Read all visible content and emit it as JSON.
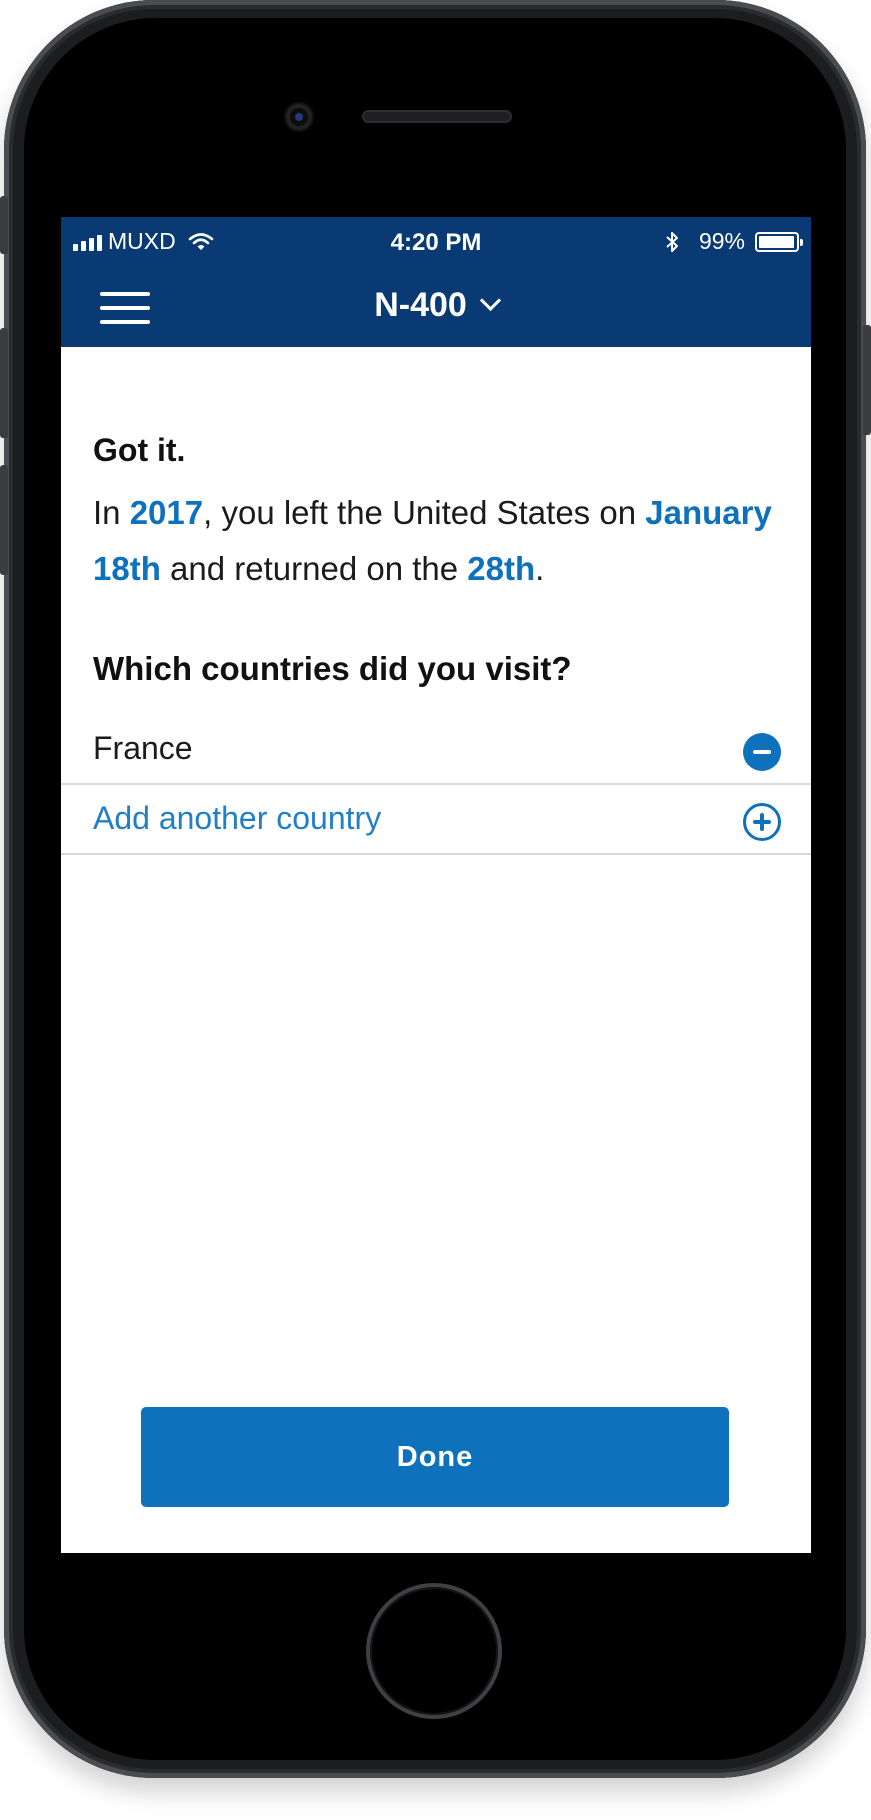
{
  "status_bar": {
    "carrier": "MUXD",
    "time": "4:20 PM",
    "battery": "99%"
  },
  "nav": {
    "title": "N-400"
  },
  "content": {
    "heading": "Got it.",
    "trip": {
      "t1": "In ",
      "year": "2017",
      "t2": ", you left the United States on ",
      "departure": "January 18th",
      "t3": " and returned on the ",
      "return": "28th",
      "t4": "."
    },
    "question": "Which countries did you visit?",
    "countries": [
      {
        "name": "France"
      }
    ],
    "add_country_label": "Add another country"
  },
  "done_button": "Done",
  "colors": {
    "header": "#0a3a73",
    "accent": "#0e71bc",
    "divider": "#d9d9d9"
  },
  "icons": [
    "menu-icon",
    "chevron-down-icon",
    "wifi-icon",
    "bluetooth-icon",
    "battery-icon",
    "minus-circle-icon",
    "plus-circle-icon"
  ]
}
